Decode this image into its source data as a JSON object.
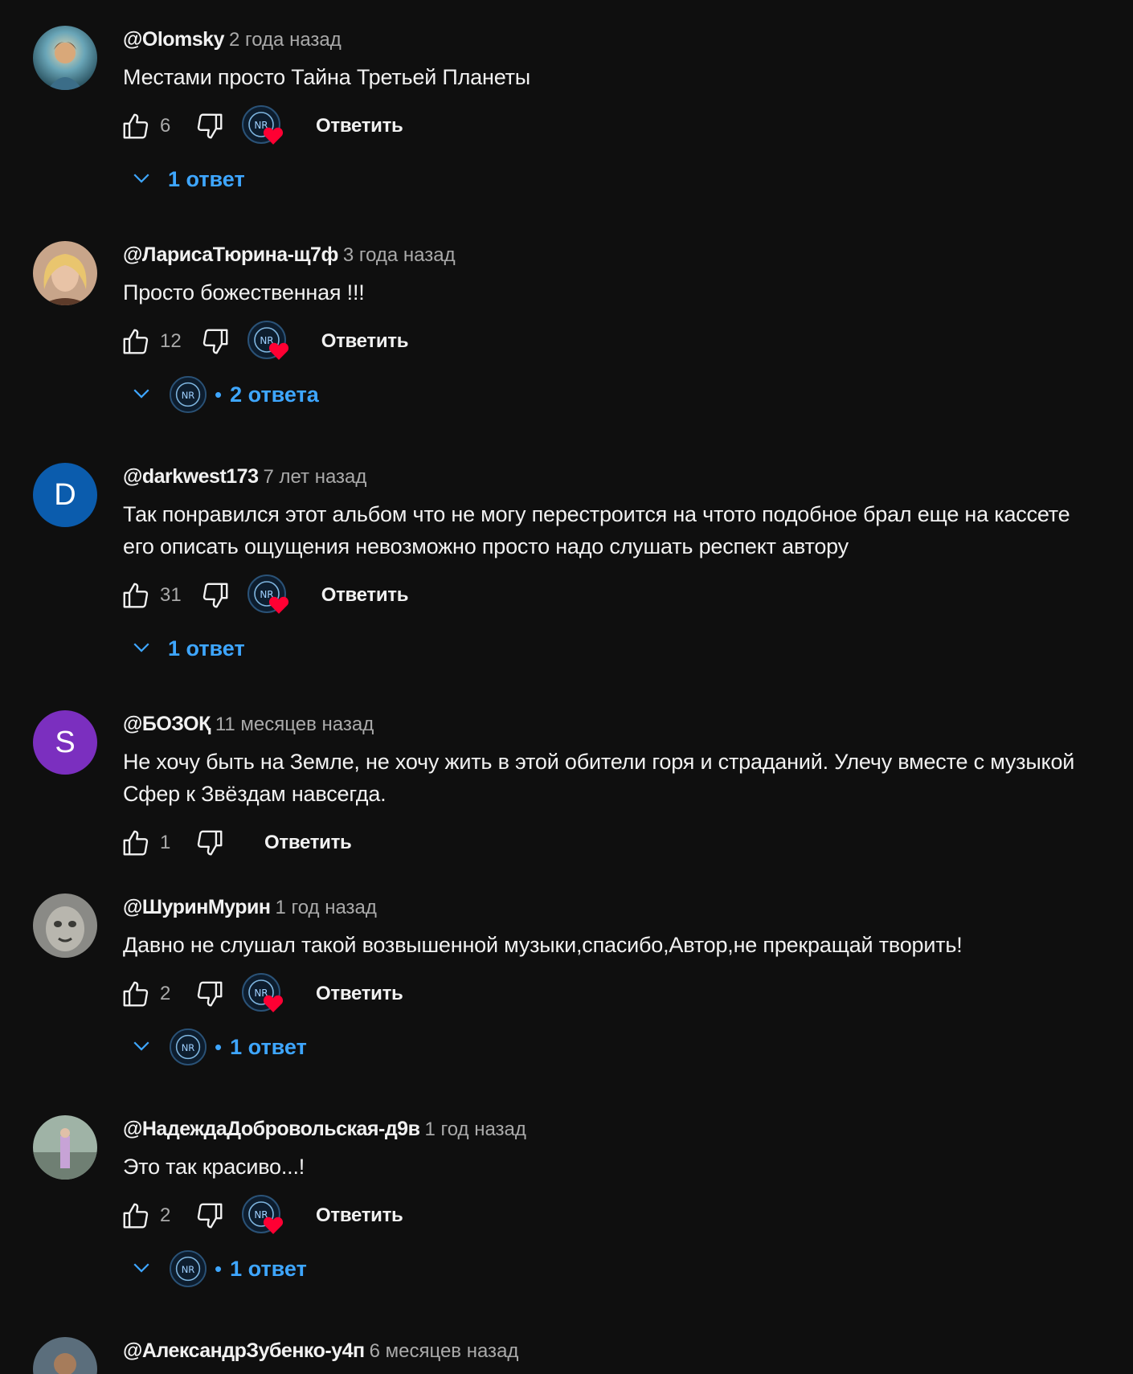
{
  "comments": [
    {
      "author": "@Olomsky",
      "time": "2 года назад",
      "text": "Местами просто Тайна Третьей Планеты",
      "likes": "6",
      "reply_label": "Ответить",
      "replies_label": "1 ответ",
      "avatar": "image"
    },
    {
      "author": "@ЛарисаТюрина-щ7ф",
      "time": "3 года назад",
      "text": "Просто божественная !!!",
      "likes": "12",
      "reply_label": "Ответить",
      "replies_label": "2 ответа",
      "avatar": "image"
    },
    {
      "author": "@darkwest173",
      "time": "7 лет назад",
      "text": "Так понравился этот альбом что не могу перестроится на чтото подобное брал еще на кассете его описать ощущения невозможно просто надо слушать респект автору",
      "likes": "31",
      "reply_label": "Ответить",
      "replies_label": "1 ответ",
      "avatar_letter": "D"
    },
    {
      "author": "@БОЗОҚ",
      "time": "11 месяцев назад",
      "text": "Не хочу быть на Земле, не хочу жить в этой обители горя и страданий. Улечу вместе с музыкой Сфер к Звёздам навсегда.",
      "likes": "1",
      "reply_label": "Ответить",
      "avatar_letter": "S"
    },
    {
      "author": "@ШуринМурин",
      "time": "1 год назад",
      "text": "Давно не слушал такой возвышенной музыки,спасибо,Автор,не прекращай творить!",
      "likes": "2",
      "reply_label": "Ответить",
      "replies_label": "1 ответ",
      "avatar": "image"
    },
    {
      "author": "@НадеждаДобровольская-д9в",
      "time": "1 год назад",
      "text": "Это так красиво...!",
      "likes": "2",
      "reply_label": "Ответить",
      "replies_label": "1 ответ",
      "avatar": "image"
    },
    {
      "author": "@АлександрЗубенко-у4п",
      "time": "6 месяцев назад",
      "avatar": "image"
    }
  ],
  "colors": {
    "background": "#0f0f0f",
    "link": "#3ea6ff",
    "heart": "#ff0033",
    "secondary_text": "#aaaaaa"
  },
  "icons": {
    "like": "thumb-up-icon",
    "dislike": "thumb-down-icon",
    "creator_heart": "creator-heart-icon",
    "expand": "chevron-down-icon"
  }
}
